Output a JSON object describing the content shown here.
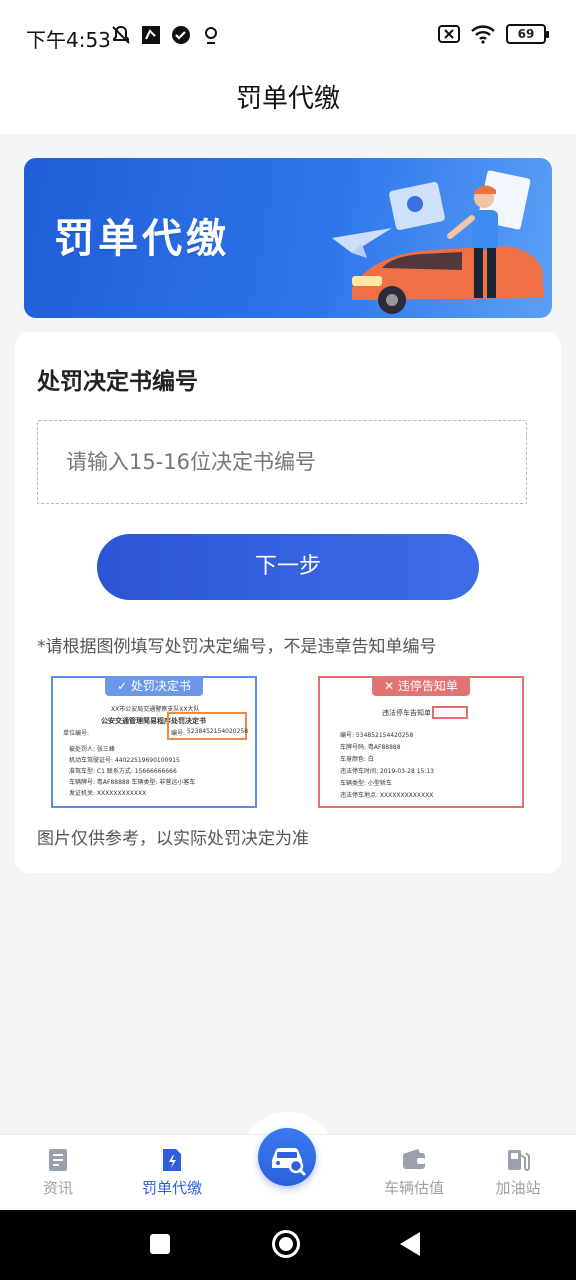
{
  "status_bar": {
    "time": "下午4:53",
    "battery": "69"
  },
  "header": {
    "title": "罚单代缴"
  },
  "banner": {
    "title": "罚单代缴"
  },
  "form": {
    "title": "处罚决定书编号",
    "input_placeholder": "请输入15-16位决定书编号",
    "next_button": "下一步",
    "hint": "*请根据图例填写处罚决定编号，不是违章告知单编号",
    "note": "图片仅供参考，以实际处罚决定为准"
  },
  "examples": {
    "good": {
      "tag": "✓ 处罚决定书",
      "heading": "XX市公安局交通警察支队XX大队",
      "subheading": "公安交通管理简易程序处罚决定书",
      "unit": "单位编号:",
      "number_label": "编号:",
      "number": "5238452154020258",
      "rows": [
        "被处罚人:  张三峰",
        "机动车驾驶证号:  44022519690100915",
        "准驾车型:  C1        联系方式:  15666666666",
        "车辆牌号:  粤AF88888     车辆类型:  非营运小客车",
        "发证机关:  XXXXXXXXXXXX"
      ]
    },
    "bad": {
      "tag": "✕ 违停告知单",
      "heading": "违法停车告知单",
      "rows": [
        "编号:  534852154420258",
        "车牌号码:  粤AF88888",
        "车身颜色:  白",
        "违法停车时间:  2019-03-28 15:13",
        "车辆类型:  小型轿车",
        "违法停车地点:  XXXXXXXXXXXXX"
      ]
    }
  },
  "bottom_nav": {
    "items": [
      {
        "label": "资讯",
        "icon": "news-icon",
        "active": false
      },
      {
        "label": "罚单代缴",
        "icon": "ticket-icon",
        "active": true
      },
      {
        "label": "",
        "icon": "car-search-icon",
        "active": false
      },
      {
        "label": "车辆估值",
        "icon": "wallet-icon",
        "active": false
      },
      {
        "label": "加油站",
        "icon": "fuel-icon",
        "active": false
      }
    ]
  },
  "colors": {
    "primary": "#2f5fdc",
    "nav_active": "#2f5fdc",
    "nav_inactive": "#9aa1ad",
    "good_border": "#5b8ee6",
    "bad_border": "#e27070"
  }
}
